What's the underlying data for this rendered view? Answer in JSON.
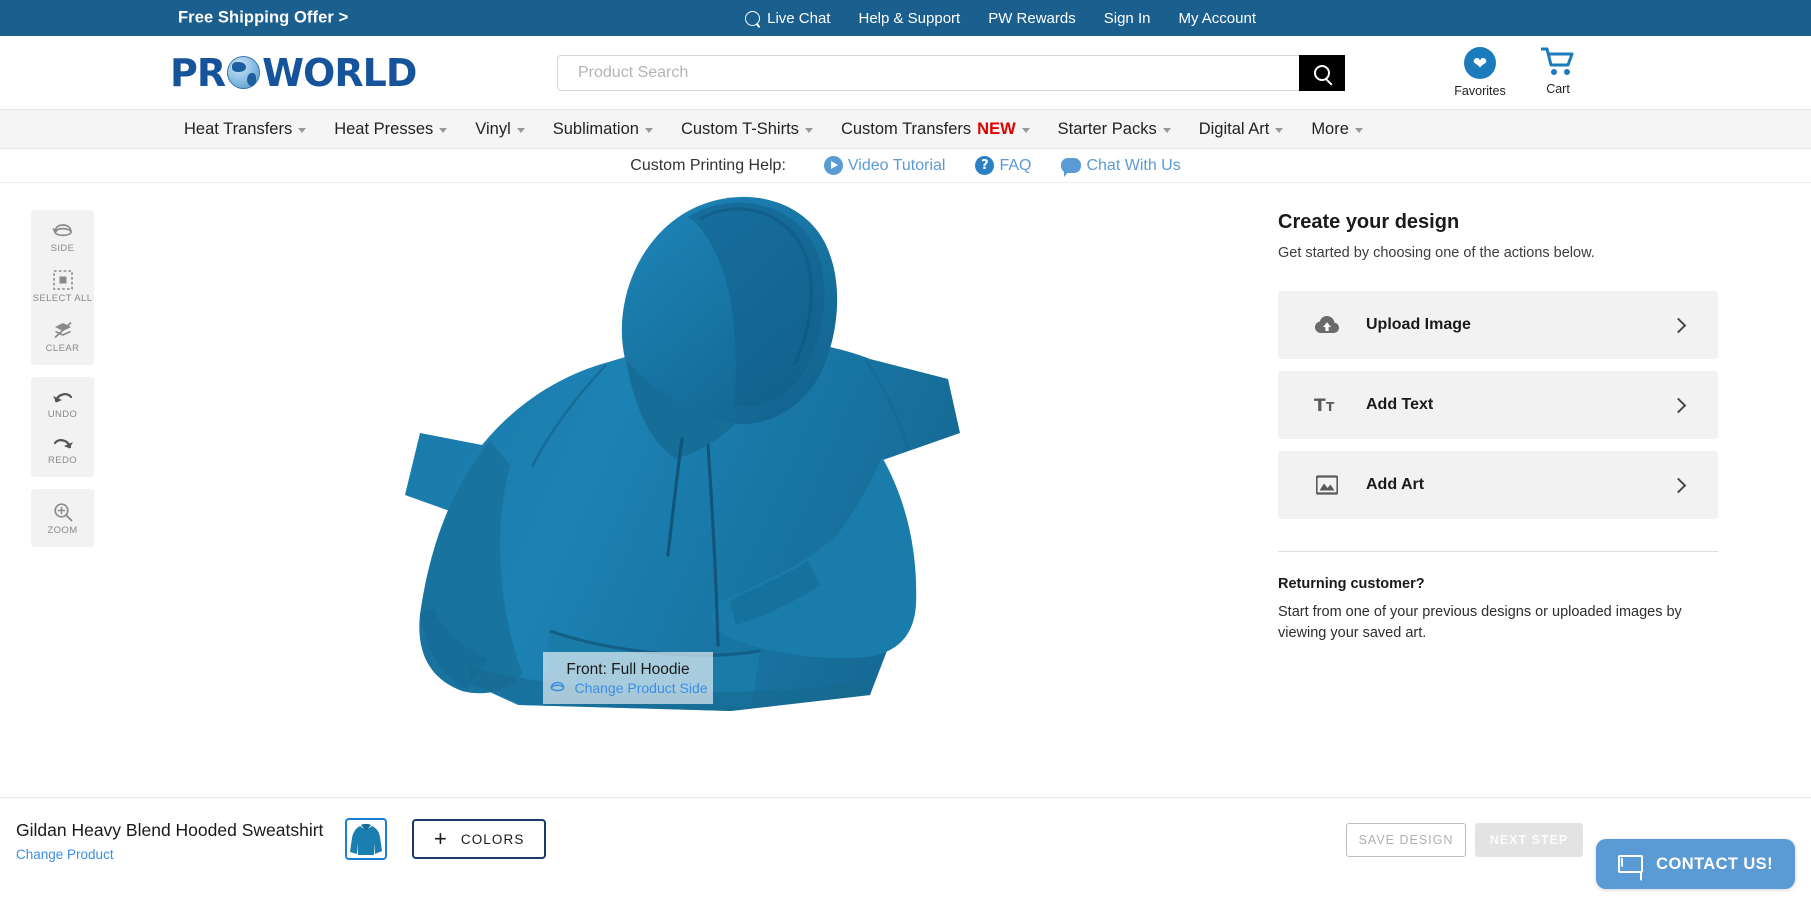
{
  "topbar": {
    "promo": "Free Shipping Offer >",
    "links": [
      {
        "label": "Live Chat",
        "icon": "chat-search-icon"
      },
      {
        "label": "Help & Support",
        "icon": ""
      },
      {
        "label": "PW Rewards",
        "icon": ""
      },
      {
        "label": "Sign In",
        "icon": ""
      },
      {
        "label": "My Account",
        "icon": ""
      }
    ]
  },
  "header": {
    "logo_pre": "PR",
    "logo_post": "WORLD",
    "search": {
      "value": "",
      "placeholder": "Product Search",
      "button_icon": "search-icon"
    },
    "favorites_label": "Favorites",
    "cart_label": "Cart"
  },
  "nav": {
    "items": [
      {
        "label": "Heat Transfers",
        "caret": true,
        "badge": ""
      },
      {
        "label": "Heat Presses",
        "caret": true,
        "badge": ""
      },
      {
        "label": "Vinyl",
        "caret": true,
        "badge": ""
      },
      {
        "label": "Sublimation",
        "caret": true,
        "badge": ""
      },
      {
        "label": "Custom T-Shirts",
        "caret": true,
        "badge": ""
      },
      {
        "label": "Custom Transfers",
        "caret": true,
        "badge": "NEW"
      },
      {
        "label": "Starter Packs",
        "caret": true,
        "badge": ""
      },
      {
        "label": "Digital Art",
        "caret": true,
        "badge": ""
      },
      {
        "label": "More",
        "caret": true,
        "badge": ""
      }
    ]
  },
  "helpbar": {
    "label": "Custom Printing Help:",
    "links": [
      {
        "label": "Video Tutorial",
        "icon": "play-icon"
      },
      {
        "label": "FAQ",
        "icon": "question-icon"
      },
      {
        "label": "Chat With Us",
        "icon": "chat-bubble-icon"
      }
    ]
  },
  "toolbar": {
    "groups": [
      [
        {
          "label": "SIDE",
          "icon": "rotate-side-icon"
        },
        {
          "label": "SELECT ALL",
          "icon": "select-all-icon"
        },
        {
          "label": "CLEAR",
          "icon": "clear-layers-icon"
        }
      ],
      [
        {
          "label": "UNDO",
          "icon": "undo-arrow-icon"
        },
        {
          "label": "REDO",
          "icon": "redo-arrow-icon"
        }
      ],
      [
        {
          "label": "ZOOM",
          "icon": "zoom-in-icon"
        }
      ]
    ]
  },
  "canvas": {
    "side_title": "Front: Full Hoodie",
    "change_side_label": "Change Product Side",
    "garment_color": "#1b7eb0",
    "garment_shadow": "#14668f"
  },
  "rightpanel": {
    "title": "Create your design",
    "subtitle": "Get started by choosing one of the actions below.",
    "actions": [
      {
        "label": "Upload Image",
        "icon": "cloud-upload-icon"
      },
      {
        "label": "Add Text",
        "icon": "text-tool-icon"
      },
      {
        "label": "Add Art",
        "icon": "image-art-icon"
      }
    ],
    "returning_title": "Returning customer?",
    "returning_body": "Start from one of your previous designs or uploaded images by viewing your saved art."
  },
  "bottombar": {
    "product_name": "Gildan Heavy Blend Hooded Sweatshirt",
    "change_product_label": "Change Product",
    "swatch_color": "#1b7eb0",
    "colors_label": "COLORS",
    "save_label": "SAVE DESIGN",
    "next_label": "NEXT STEP"
  },
  "contact": {
    "label": "CONTACT US!",
    "icon": "envelope-icon",
    "color": "#5b9bd5"
  },
  "colors": {
    "brand_blue": "#1a5f8e",
    "logo_blue": "#15539b",
    "accent_link": "#3d8ee0",
    "nav_bg": "#f5f5f5",
    "new_badge": "#e00000"
  }
}
